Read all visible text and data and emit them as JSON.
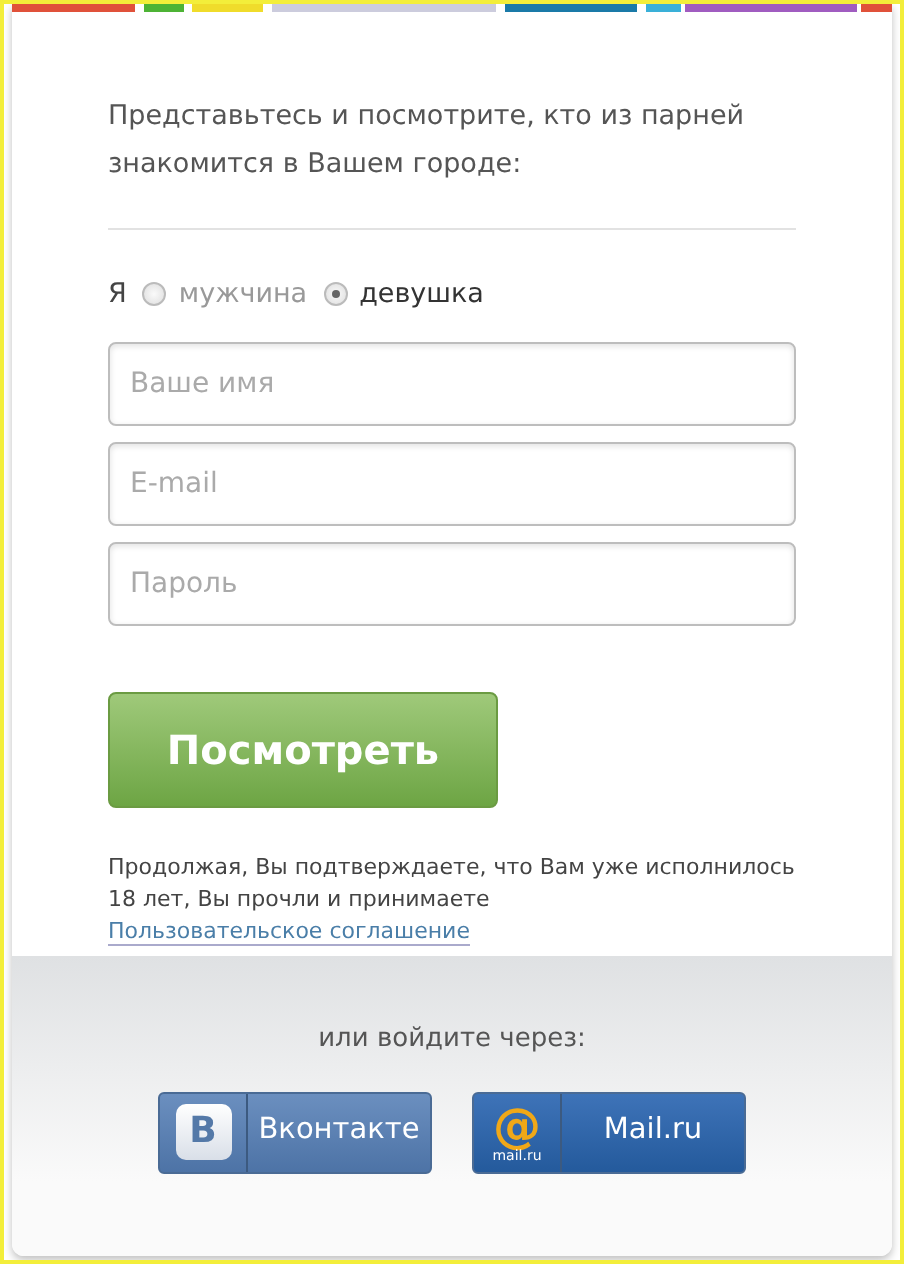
{
  "intro": "Представьтесь и посмотрите, кто из парней знакомится в Вашем городе:",
  "gender": {
    "label": "Я",
    "options": [
      {
        "label": "мужчина",
        "selected": false
      },
      {
        "label": "девушка",
        "selected": true
      }
    ]
  },
  "fields": [
    {
      "placeholder": "Ваше имя"
    },
    {
      "placeholder": "E-mail"
    },
    {
      "placeholder": "Пароль"
    }
  ],
  "submit": "Посмотреть",
  "terms": {
    "text": "Продолжая, Вы подтверждаете, что Вам уже исполнилось 18 лет, Вы прочли и принимаете ",
    "link": "Пользовательское соглашение"
  },
  "social": {
    "caption": "или войдите через:",
    "buttons": [
      {
        "kind": "vk",
        "logo": "В",
        "label": "Вконтакте"
      },
      {
        "kind": "mail",
        "logo": "@",
        "logo_caption": "mail.ru",
        "label": "Mail.ru"
      }
    ]
  }
}
